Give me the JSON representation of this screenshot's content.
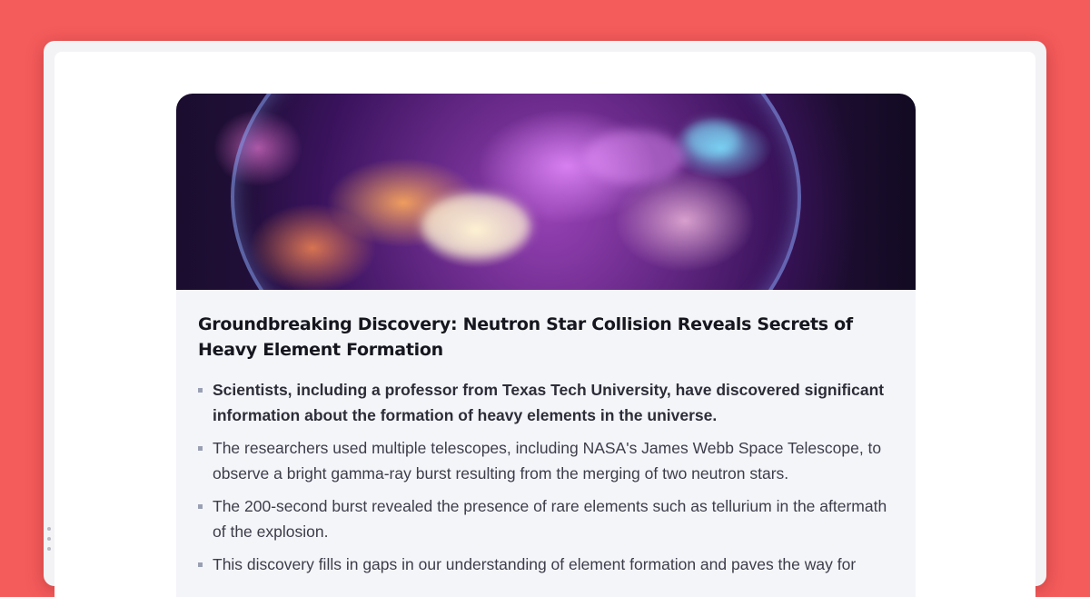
{
  "article": {
    "image_alt": "Neutron star collision illustration",
    "title": "Groundbreaking Discovery: Neutron Star Collision Reveals Secrets of Heavy Element Formation",
    "bullets": [
      "Scientists, including a professor from Texas Tech University, have discovered significant information about the formation of heavy elements in the universe.",
      "The researchers used multiple telescopes, including NASA's James Webb Space Telescope, to observe a bright gamma-ray burst resulting from the merging of two neutron stars.",
      "The 200-second burst revealed the presence of rare elements such as tellurium in the aftermath of the explosion.",
      "This discovery fills in gaps in our understanding of element formation and paves the way for"
    ]
  },
  "colors": {
    "background": "#f45b5b",
    "card": "#f4f5f9",
    "title": "#16161f",
    "body_text": "#3d3d4a"
  },
  "icons": [
    "drag-handle-icon"
  ]
}
